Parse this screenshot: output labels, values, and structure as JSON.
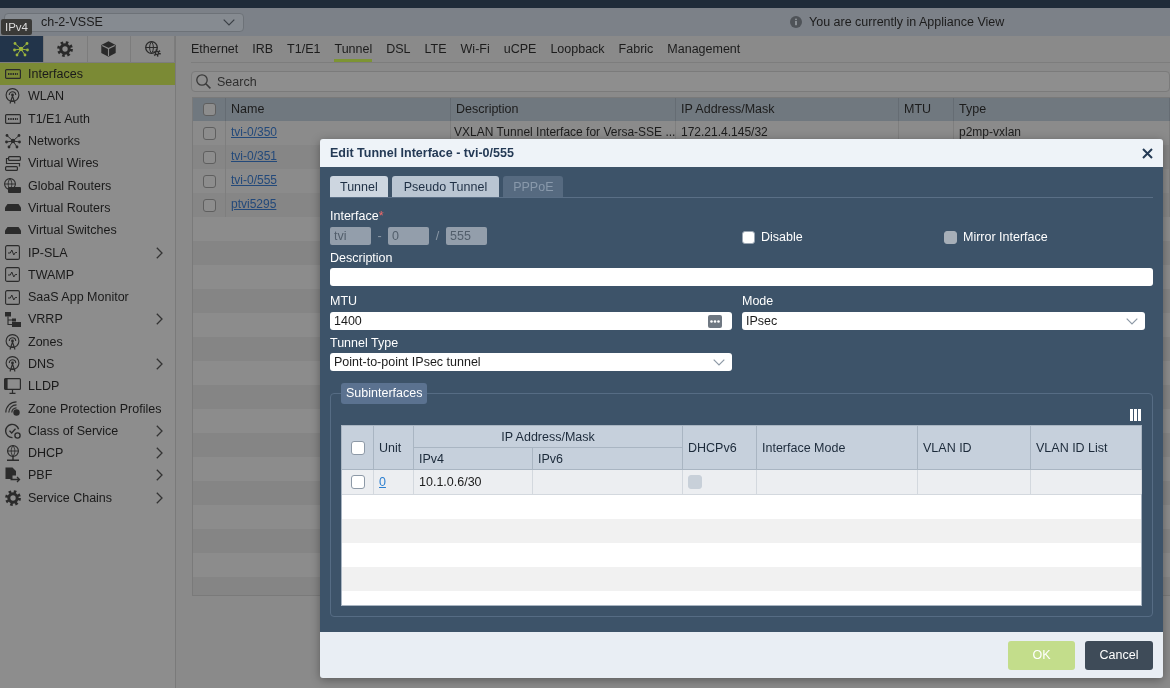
{
  "header": {
    "device_select": {
      "value": "ch-2-VSSE"
    },
    "tooltip": "IPv4",
    "notice": "You are currently in Appliance View"
  },
  "sidebar": {
    "icon_tabs": [
      {
        "kind": "network",
        "selected": true
      },
      {
        "kind": "gear",
        "selected": false
      },
      {
        "kind": "cube",
        "selected": false
      },
      {
        "kind": "globe-gear",
        "selected": false
      }
    ],
    "items": [
      {
        "label": "Interfaces",
        "kind": "port",
        "selected": true,
        "expandable": false
      },
      {
        "label": "WLAN",
        "kind": "antenna",
        "selected": false,
        "expandable": false
      },
      {
        "label": "T1/E1 Auth",
        "kind": "port",
        "selected": false,
        "expandable": false
      },
      {
        "label": "Networks",
        "kind": "network",
        "selected": false,
        "expandable": false
      },
      {
        "label": "Virtual Wires",
        "kind": "cable",
        "selected": false,
        "expandable": false
      },
      {
        "label": "Global Routers",
        "kind": "globe-router",
        "selected": false,
        "expandable": false
      },
      {
        "label": "Virtual Routers",
        "kind": "device",
        "selected": false,
        "expandable": false
      },
      {
        "label": "Virtual Switches",
        "kind": "device",
        "selected": false,
        "expandable": false
      },
      {
        "label": "IP-SLA",
        "kind": "pulse",
        "selected": false,
        "expandable": true
      },
      {
        "label": "TWAMP",
        "kind": "pulse",
        "selected": false,
        "expandable": false
      },
      {
        "label": "SaaS App Monitor",
        "kind": "pulse",
        "selected": false,
        "expandable": false
      },
      {
        "label": "VRRP",
        "kind": "hierarchy",
        "selected": false,
        "expandable": true
      },
      {
        "label": "Zones",
        "kind": "antenna",
        "selected": false,
        "expandable": false
      },
      {
        "label": "DNS",
        "kind": "antenna",
        "selected": false,
        "expandable": true
      },
      {
        "label": "LLDP",
        "kind": "monitor",
        "selected": false,
        "expandable": false
      },
      {
        "label": "Zone Protection Profiles",
        "kind": "signal",
        "selected": false,
        "expandable": false
      },
      {
        "label": "Class of Service",
        "kind": "gauge",
        "selected": false,
        "expandable": true
      },
      {
        "label": "DHCP",
        "kind": "globe",
        "selected": false,
        "expandable": true
      },
      {
        "label": "PBF",
        "kind": "document",
        "selected": false,
        "expandable": true
      },
      {
        "label": "Service Chains",
        "kind": "gear",
        "selected": false,
        "expandable": true
      }
    ]
  },
  "tabs": [
    {
      "label": "Ethernet",
      "selected": false
    },
    {
      "label": "IRB",
      "selected": false
    },
    {
      "label": "T1/E1",
      "selected": false
    },
    {
      "label": "Tunnel",
      "selected": true
    },
    {
      "label": "DSL",
      "selected": false
    },
    {
      "label": "LTE",
      "selected": false
    },
    {
      "label": "Wi-Fi",
      "selected": false
    },
    {
      "label": "uCPE",
      "selected": false
    },
    {
      "label": "Loopback",
      "selected": false
    },
    {
      "label": "Fabric",
      "selected": false
    },
    {
      "label": "Management",
      "selected": false
    }
  ],
  "search": {
    "placeholder": "Search"
  },
  "table": {
    "all_checked": false,
    "columns": [
      "Name",
      "Description",
      "IP Address/Mask",
      "MTU",
      "Type"
    ],
    "rows": [
      {
        "checked": false,
        "name": "tvi-0/350",
        "description": "VXLAN Tunnel Interface for Versa-SSE ...",
        "ip_address": "172.21.4.145/32",
        "type": "p2mp-vxlan"
      },
      {
        "checked": false,
        "name": "tvi-0/351"
      },
      {
        "checked": false,
        "name": "tvi-0/555"
      },
      {
        "checked": false,
        "name": "ptvi5295"
      }
    ]
  },
  "dialog": {
    "title": "Edit Tunnel Interface - tvi-0/555",
    "tabs": [
      {
        "label": "Tunnel",
        "selected": true,
        "disabled": false
      },
      {
        "label": "Pseudo Tunnel",
        "selected": false,
        "disabled": false
      },
      {
        "label": "PPPoE",
        "selected": false,
        "disabled": true
      }
    ],
    "interface": {
      "label": "Interface",
      "required_mark": "*",
      "parts": [
        {
          "value": "tvi",
          "disabled": true
        },
        {
          "separator": "-",
          "value": "0",
          "disabled": true
        },
        {
          "separator": "/",
          "value": "555",
          "disabled": true
        }
      ]
    },
    "disable": {
      "label": "Disable",
      "checked": false,
      "disabled": false
    },
    "mirror_interface": {
      "label": "Mirror Interface",
      "checked": false,
      "disabled": true
    },
    "description": {
      "label": "Description"
    },
    "mtu": {
      "label": "MTU",
      "value": "1400"
    },
    "mode": {
      "label": "Mode",
      "value": "IPsec"
    },
    "tunnel_type": {
      "label": "Tunnel Type",
      "value": "Point-to-point IPsec tunnel"
    },
    "subinterfaces": {
      "title": "Subinterfaces",
      "all_checked": false,
      "group_header": "IP Address/Mask",
      "columns": [
        "Unit",
        "IPv4",
        "IPv6",
        "DHCPv6",
        "Interface Mode",
        "VLAN ID",
        "VLAN ID List"
      ],
      "rows": [
        {
          "checked": false,
          "unit": "0",
          "ipv4": "10.1.0.6/30",
          "dhcpv6": {
            "checked": false,
            "disabled": true
          }
        }
      ]
    },
    "buttons": [
      {
        "label": "OK",
        "kind": "primary"
      },
      {
        "label": "Cancel",
        "kind": "secondary"
      }
    ]
  }
}
